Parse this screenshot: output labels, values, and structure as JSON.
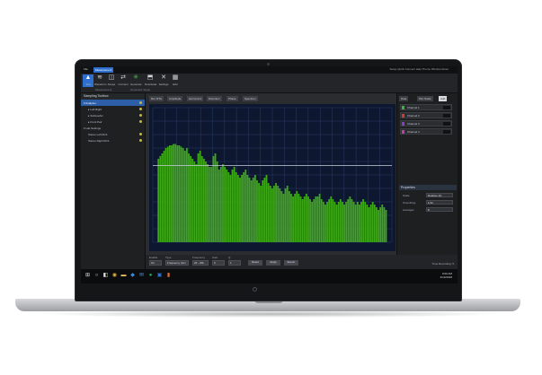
{
  "app": {
    "file_tab": "File",
    "measure_tab": "Measurement",
    "title_right": "Setup Quick Connect   Help   Theme   Window   About"
  },
  "ribbon": {
    "buttons": [
      {
        "label": "Test",
        "icon": "play-icon",
        "glyph": "▲"
      },
      {
        "label": "Waveform",
        "icon": "waveform-icon",
        "glyph": "≋"
      },
      {
        "label": "Scope",
        "icon": "scope-icon",
        "glyph": "◫"
      },
      {
        "label": "Connect",
        "icon": "connect-icon",
        "glyph": "⇄"
      },
      {
        "label": "Generate",
        "icon": "generate-icon",
        "glyph": "✳"
      },
      {
        "label": "Download",
        "icon": "download-icon",
        "glyph": "⬒"
      },
      {
        "label": "Settings",
        "icon": "settings-icon",
        "glyph": "✕"
      },
      {
        "label": "Edit",
        "icon": "edit-icon",
        "glyph": "▦"
      }
    ],
    "group_left": "Measurement",
    "group_right": "Generator Setup"
  },
  "left_panel": {
    "header": "Sampling Toolbox",
    "items": [
      {
        "label": "▾ Analyzer",
        "selected": true
      },
      {
        "label": "▸ Left Right",
        "selected": false
      },
      {
        "label": "▸ Subwoofer",
        "selected": false
      },
      {
        "label": "▸ Front Pair",
        "selected": false
      },
      {
        "label": "▾ Lab Settings",
        "selected": false
      },
      {
        "label": "Stereo Left RLS",
        "selected": false
      },
      {
        "label": "Stereo Right RLS",
        "selected": false
      }
    ]
  },
  "graph_tabs": [
    "Rel. RTA",
    "Amplitude",
    "Harmonics",
    "Distortion",
    "Phase",
    "Spectrum"
  ],
  "chart_data": {
    "type": "bar",
    "title": "",
    "xlabel": "",
    "ylabel": "",
    "ylim": [
      0,
      100
    ],
    "bar_color": "#3fa81a",
    "reference_line": 57,
    "values": [
      62,
      64,
      66,
      68,
      70,
      71,
      72,
      72,
      73,
      73,
      72,
      72,
      71,
      70,
      68,
      70,
      66,
      64,
      62,
      60,
      58,
      66,
      68,
      64,
      62,
      60,
      58,
      56,
      56,
      64,
      66,
      60,
      54,
      56,
      58,
      56,
      54,
      52,
      50,
      54,
      56,
      52,
      50,
      48,
      50,
      52,
      54,
      50,
      48,
      46,
      48,
      50,
      46,
      44,
      42,
      46,
      48,
      50,
      44,
      42,
      40,
      42,
      44,
      42,
      40,
      38,
      36,
      40,
      42,
      38,
      36,
      34,
      36,
      38,
      36,
      34,
      32,
      34,
      36,
      34,
      32,
      30,
      32,
      34,
      34,
      36,
      32,
      30,
      28,
      30,
      32,
      34,
      32,
      30,
      28,
      30,
      32,
      30,
      28,
      30,
      32,
      34,
      32,
      30,
      28,
      30,
      28,
      30,
      32,
      30,
      28,
      26,
      28,
      30,
      28,
      26,
      24,
      26,
      28,
      26,
      24
    ]
  },
  "controls": {
    "enable_label": "Enable",
    "enable_value": "On",
    "type_label": "Type",
    "type_value": "Frequency (Hz)",
    "frequency_label": "Frequency",
    "frequency_value": "20 - 20k",
    "gain_label": "Gain",
    "gain_value": "0",
    "q_label": "Q",
    "q_value": "1",
    "button_a": "Reset",
    "button_b": "Apply",
    "button_c": "Export",
    "status": "Time Recording: 5"
  },
  "right_panel": {
    "tabs": [
      "Data",
      "Plot Scale",
      "Add"
    ],
    "traces": [
      {
        "name": "Channel 1",
        "color": "#3cb043"
      },
      {
        "name": "Channel 2",
        "color": "#d03a3a"
      },
      {
        "name": "Channel 3",
        "color": "#8a3cc8"
      },
      {
        "name": "Channel 4",
        "color": "#c23ca8"
      }
    ],
    "section": "Properties",
    "props": [
      {
        "label": "Scale",
        "value": "Relative (0)"
      },
      {
        "label": "Smoothing",
        "value": "1/12"
      },
      {
        "label": "Averages",
        "value": "8"
      }
    ]
  },
  "taskbar": {
    "icons": [
      {
        "name": "windows-icon",
        "glyph": "⊞"
      },
      {
        "name": "search-icon",
        "glyph": "○"
      },
      {
        "name": "taskview-icon",
        "glyph": "◧"
      },
      {
        "name": "browser-icon",
        "glyph": "◉"
      },
      {
        "name": "folder-icon",
        "glyph": "▬"
      },
      {
        "name": "store-icon",
        "glyph": "◆"
      },
      {
        "name": "mail-icon",
        "glyph": "✉"
      },
      {
        "name": "spotify-icon",
        "glyph": "●"
      },
      {
        "name": "media-icon",
        "glyph": "▣"
      },
      {
        "name": "app-icon",
        "glyph": "▮"
      }
    ],
    "time": "9:00 AM",
    "date": "4/13/2018"
  }
}
